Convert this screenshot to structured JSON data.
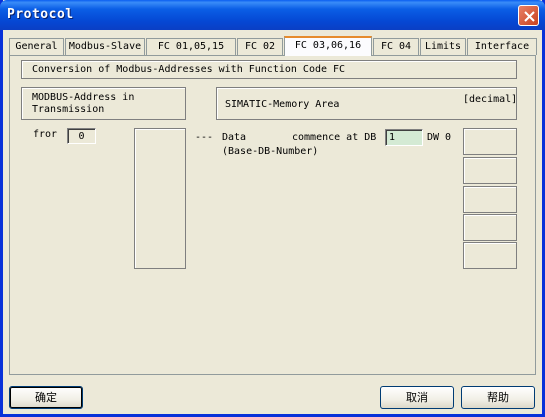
{
  "window": {
    "title": "Protocol"
  },
  "tabs": [
    {
      "label": "General"
    },
    {
      "label": "Modbus-Slave"
    },
    {
      "label": "FC 01,05,15"
    },
    {
      "label": "FC 02"
    },
    {
      "label": "FC 03,06,16"
    },
    {
      "label": "FC 04"
    },
    {
      "label": "Limits"
    },
    {
      "label": "Interface"
    }
  ],
  "active_tab": "FC 03,06,16",
  "panel": {
    "heading": "Conversion of  Modbus-Addresses  with  Function Code  FC",
    "modbus_header_line1": "MODBUS-Address in",
    "modbus_header_line2": "Transmission",
    "simatic_header": "SIMATIC-Memory Area",
    "decimal_label": "[decimal]",
    "from_label": "fror",
    "from_value": "0",
    "dashes": "---",
    "data_label": "Data",
    "commence_label": "commence at DB",
    "db_value": "1",
    "dw_label": "DW 0",
    "base_db_label": "(Base-DB-Number)"
  },
  "buttons": {
    "ok": "确定",
    "cancel": "取消",
    "help": "帮助"
  },
  "colors": {
    "titlebar": "#0548d4",
    "active_tab_accent": "#e68b2c",
    "db_field": "#d4ead4",
    "dialog_bg": "#ece9d8"
  }
}
